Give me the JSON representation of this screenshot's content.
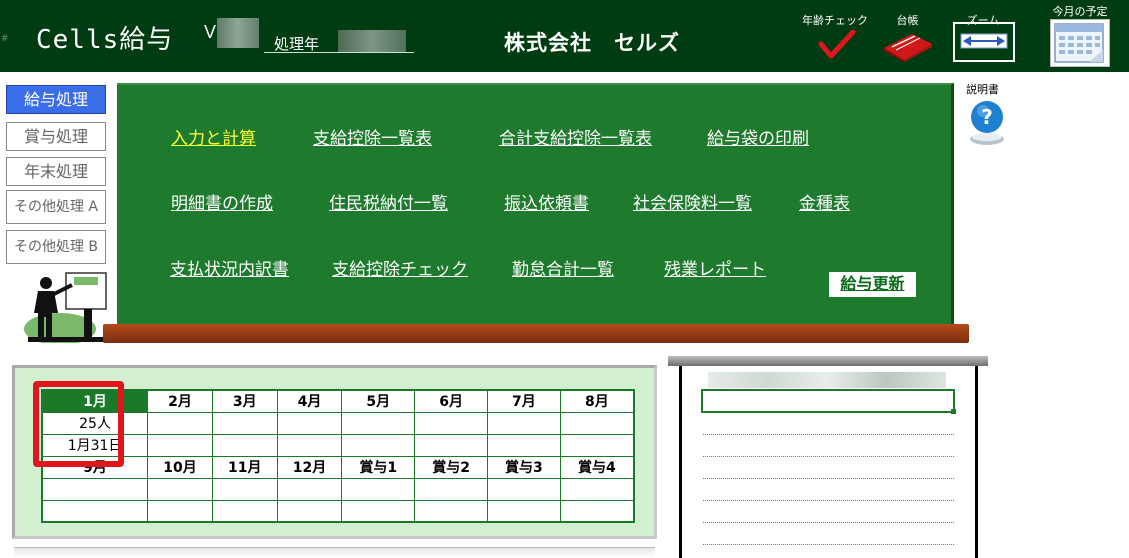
{
  "header": {
    "hash": "#",
    "app_title": "Cells給与",
    "version_prefix": "V",
    "proc_year_label": "処理年",
    "company": "株式会社　セルズ",
    "tools": {
      "age_check": "年齢チェック",
      "ledger": "台帳",
      "zoom": "ズーム",
      "schedule": "今月の予定"
    }
  },
  "nav": {
    "items": [
      "給与処理",
      "賞与処理",
      "年末処理",
      "その他処理 A",
      "その他処理 B"
    ],
    "active_index": 0
  },
  "help": {
    "label": "説明書"
  },
  "menu": {
    "row1": [
      "入力と計算",
      "支給控除一覧表",
      "合計支給控除一覧表",
      "給与袋の印刷"
    ],
    "row2": [
      "明細書の作成",
      "住民税納付一覧",
      "振込依頼書",
      "社会保険料一覧",
      "金種表"
    ],
    "row3": [
      "支払状況内訳書",
      "支給控除チェック",
      "勤怠合計一覧",
      "残業レポート"
    ],
    "update_button": "給与更新"
  },
  "months": {
    "row1": [
      "1月",
      "2月",
      "3月",
      "4月",
      "5月",
      "6月",
      "7月",
      "8月"
    ],
    "row2": [
      "9月",
      "10月",
      "11月",
      "12月",
      "賞与1",
      "賞与2",
      "賞与3",
      "賞与4"
    ],
    "selected": {
      "count": "25人",
      "date": "1月31日"
    }
  },
  "colors": {
    "header_bg": "#003c12",
    "board_green": "#1e7a2c",
    "highlight_link": "#ffff33",
    "nav_active": "#3a6ee8",
    "selection_frame": "#e0161c"
  }
}
